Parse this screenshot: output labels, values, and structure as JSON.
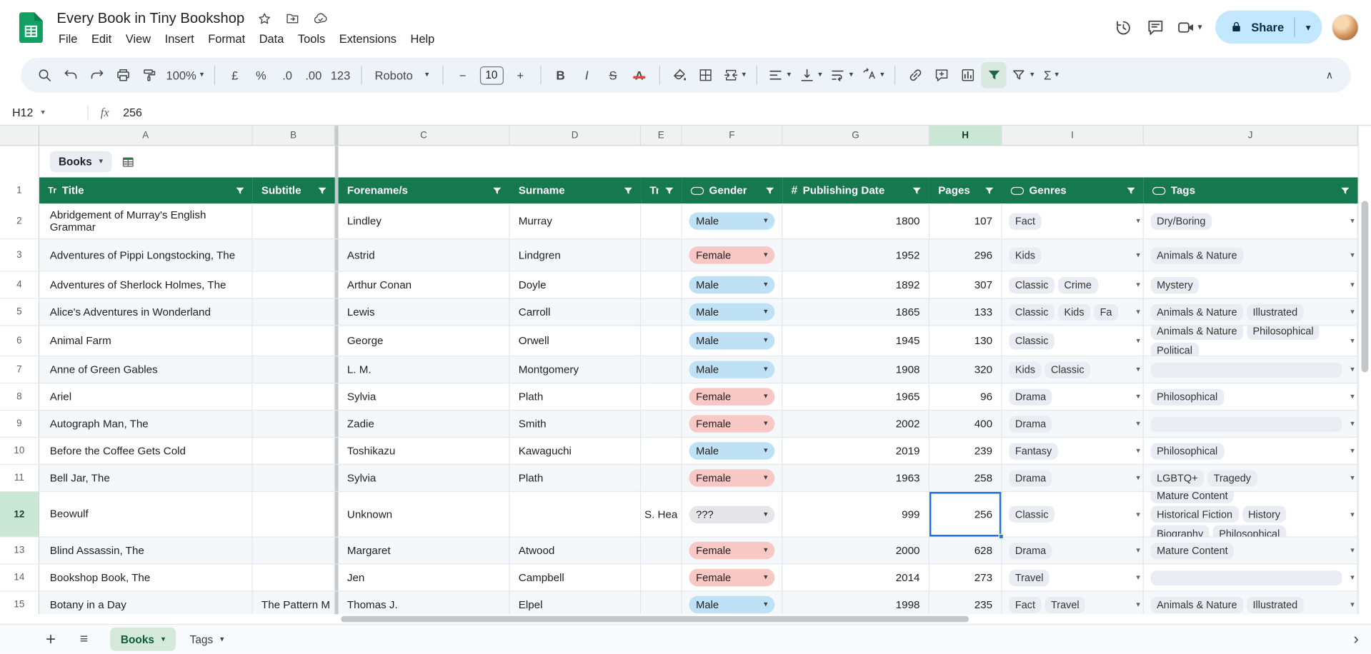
{
  "app": {
    "title": "Every Book in Tiny Bookshop",
    "share_label": "Share",
    "menus": [
      "File",
      "Edit",
      "View",
      "Insert",
      "Format",
      "Data",
      "Tools",
      "Extensions",
      "Help"
    ]
  },
  "toolbar": {
    "items": [
      {
        "name": "search",
        "icon": "search"
      },
      {
        "name": "undo",
        "icon": "undo"
      },
      {
        "name": "redo",
        "icon": "redo"
      },
      {
        "name": "print",
        "icon": "print"
      },
      {
        "name": "paint-format",
        "icon": "paint"
      },
      {
        "name": "zoom",
        "label": "100%",
        "caret": true
      },
      {
        "divider": true
      },
      {
        "name": "currency-format",
        "label": "£"
      },
      {
        "name": "percent-format",
        "label": "%"
      },
      {
        "name": "decrease-decimal",
        "label": ".0"
      },
      {
        "name": "increase-decimal",
        "label": ".00"
      },
      {
        "name": "more-number-formats",
        "label": "123"
      },
      {
        "divider": true
      },
      {
        "name": "font",
        "label": "Roboto",
        "caret": true,
        "wide": true
      },
      {
        "divider": true
      },
      {
        "name": "decrease-font-size",
        "label": "−"
      },
      {
        "name": "font-size",
        "label": "10",
        "box": true
      },
      {
        "name": "increase-font-size",
        "label": "+"
      },
      {
        "divider": true
      },
      {
        "name": "bold",
        "label": "B",
        "style": "b"
      },
      {
        "name": "italic",
        "label": "I",
        "style": "i"
      },
      {
        "name": "strikethrough",
        "label": "S",
        "style": "s"
      },
      {
        "name": "text-color",
        "label": "A",
        "style": "a"
      },
      {
        "divider": true
      },
      {
        "name": "fill-color",
        "icon": "fill"
      },
      {
        "name": "borders",
        "icon": "borders"
      },
      {
        "name": "merge-cells",
        "icon": "merge",
        "caret": true
      },
      {
        "divider": true
      },
      {
        "name": "horizontal-align",
        "icon": "align",
        "caret": true
      },
      {
        "name": "vertical-align",
        "icon": "valign",
        "caret": true
      },
      {
        "name": "text-wrapping",
        "icon": "wrap",
        "caret": true
      },
      {
        "name": "text-rotation",
        "icon": "rotate",
        "caret": true
      },
      {
        "divider": true
      },
      {
        "name": "insert-link",
        "icon": "link"
      },
      {
        "name": "insert-comment",
        "icon": "comment"
      },
      {
        "name": "insert-chart",
        "icon": "chart"
      },
      {
        "name": "create-filter",
        "icon": "funnel",
        "active": true
      },
      {
        "name": "filter-views",
        "icon": "filterviews",
        "caret": true
      },
      {
        "name": "functions",
        "label": "Σ",
        "style": "sum",
        "caret": true
      }
    ]
  },
  "formula_bar": {
    "cell_ref": "H12",
    "fx_label": "fx",
    "value": "256"
  },
  "grid": {
    "column_letters": [
      "A",
      "B",
      "C",
      "D",
      "E",
      "F",
      "G",
      "H",
      "I",
      "J"
    ],
    "active_column": "H",
    "active_row": 12
  },
  "table": {
    "name": "Books",
    "columns": [
      {
        "label": "Title",
        "type": "text"
      },
      {
        "label": "Subtitle",
        "type": "none"
      },
      {
        "label": "Forename/s",
        "type": "none"
      },
      {
        "label": "Surname",
        "type": "none"
      },
      {
        "label": "Tr",
        "type": "none"
      },
      {
        "label": "Gender",
        "type": "dropdown"
      },
      {
        "label": "Publishing Date",
        "type": "number"
      },
      {
        "label": "Pages",
        "type": "none"
      },
      {
        "label": "Genres",
        "type": "dropdown"
      },
      {
        "label": "Tags",
        "type": "dropdown"
      }
    ],
    "rows": [
      {
        "n": 2,
        "title": "Abridgement of Murray's English Grammar",
        "forename": "Lindley",
        "surname": "Murray",
        "gender": "Male",
        "gender_kind": "male",
        "date": "1800",
        "pages": "107",
        "genres": [
          "Fact"
        ],
        "tags": [
          [
            "Dry/Boring"
          ]
        ]
      },
      {
        "n": 3,
        "title": "Adventures of Pippi Longstocking, The",
        "forename": "Astrid",
        "surname": "Lindgren",
        "gender": "Female",
        "gender_kind": "female",
        "date": "1952",
        "pages": "296",
        "genres": [
          "Kids"
        ],
        "tags": [
          [
            "Animals & Nature"
          ]
        ]
      },
      {
        "n": 4,
        "title": "Adventures of Sherlock Holmes, The",
        "forename": "Arthur Conan",
        "surname": "Doyle",
        "gender": "Male",
        "gender_kind": "male",
        "date": "1892",
        "pages": "307",
        "genres": [
          "Classic",
          "Crime"
        ],
        "tags": [
          [
            "Mystery"
          ]
        ]
      },
      {
        "n": 5,
        "title": "Alice's Adventures in Wonderland",
        "forename": "Lewis",
        "surname": "Carroll",
        "gender": "Male",
        "gender_kind": "male",
        "date": "1865",
        "pages": "133",
        "genres": [
          "Classic",
          "Kids",
          "Fa"
        ],
        "tags": [
          [
            "Animals & Nature",
            "Illustrated"
          ]
        ]
      },
      {
        "n": 6,
        "title": "Animal Farm",
        "forename": "George",
        "surname": "Orwell",
        "gender": "Male",
        "gender_kind": "male",
        "date": "1945",
        "pages": "130",
        "genres": [
          "Classic"
        ],
        "tags": [
          [
            "Animals & Nature",
            "Philosophical"
          ],
          [
            "Political"
          ]
        ]
      },
      {
        "n": 7,
        "title": "Anne of Green Gables",
        "forename": "L. M.",
        "surname": "Montgomery",
        "gender": "Male",
        "gender_kind": "male",
        "date": "1908",
        "pages": "320",
        "genres": [
          "Kids",
          "Classic"
        ],
        "tags": []
      },
      {
        "n": 8,
        "title": "Ariel",
        "forename": "Sylvia",
        "surname": "Plath",
        "gender": "Female",
        "gender_kind": "female",
        "date": "1965",
        "pages": "96",
        "genres": [
          "Drama"
        ],
        "tags": [
          [
            "Philosophical"
          ]
        ]
      },
      {
        "n": 9,
        "title": "Autograph Man, The",
        "forename": "Zadie",
        "surname": "Smith",
        "gender": "Female",
        "gender_kind": "female",
        "date": "2002",
        "pages": "400",
        "genres": [
          "Drama"
        ],
        "tags": []
      },
      {
        "n": 10,
        "title": "Before the Coffee Gets Cold",
        "forename": "Toshikazu",
        "surname": "Kawaguchi",
        "gender": "Male",
        "gender_kind": "male",
        "date": "2019",
        "pages": "239",
        "genres": [
          "Fantasy"
        ],
        "tags": [
          [
            "Philosophical"
          ]
        ]
      },
      {
        "n": 11,
        "title": "Bell Jar, The",
        "forename": "Sylvia",
        "surname": "Plath",
        "gender": "Female",
        "gender_kind": "female",
        "date": "1963",
        "pages": "258",
        "genres": [
          "Drama"
        ],
        "tags": [
          [
            "LGBTQ+",
            "Tragedy"
          ]
        ]
      },
      {
        "n": 12,
        "title": "Beowulf",
        "forename": "Unknown",
        "translator": "S. Hea",
        "gender": "???",
        "gender_kind": "unknown",
        "date": "999",
        "pages": "256",
        "genres": [
          "Classic"
        ],
        "tags": [
          [
            "Mature Content"
          ],
          [
            "Historical Fiction",
            "History"
          ],
          [
            "Biography",
            "Philosophical"
          ]
        ],
        "selected_cell": "pages"
      },
      {
        "n": 13,
        "title": "Blind Assassin, The",
        "forename": "Margaret",
        "surname": "Atwood",
        "gender": "Female",
        "gender_kind": "female",
        "date": "2000",
        "pages": "628",
        "genres": [
          "Drama"
        ],
        "tags": [
          [
            "Mature Content"
          ]
        ]
      },
      {
        "n": 14,
        "title": "Bookshop Book, The",
        "forename": "Jen",
        "surname": "Campbell",
        "gender": "Female",
        "gender_kind": "female",
        "date": "2014",
        "pages": "273",
        "genres": [
          "Travel"
        ],
        "tags": []
      },
      {
        "n": 15,
        "title": "Botany in a Day",
        "subtitle": "The Pattern M",
        "forename": "Thomas J.",
        "surname": "Elpel",
        "gender": "Male",
        "gender_kind": "male",
        "date": "1998",
        "pages": "235",
        "genres": [
          "Fact",
          "Travel"
        ],
        "tags": [
          [
            "Animals & Nature",
            "Illustrated"
          ]
        ]
      }
    ]
  },
  "sheet_tabs": [
    {
      "label": "Books",
      "active": true
    },
    {
      "label": "Tags",
      "active": false
    }
  ],
  "colors": {
    "table_header_green": "#16784E",
    "male_chip": "#BFE1F6",
    "female_chip": "#F7C8C4",
    "unknown_chip": "#E4E6E9",
    "tag_chip": "#E9EDF3",
    "selection_blue": "#1A73E8",
    "share_button_bg": "#C2E7FF",
    "active_tab_bg": "#D5E8DC",
    "filter_active_green": "#146C43",
    "logo_green": "#12A164"
  }
}
